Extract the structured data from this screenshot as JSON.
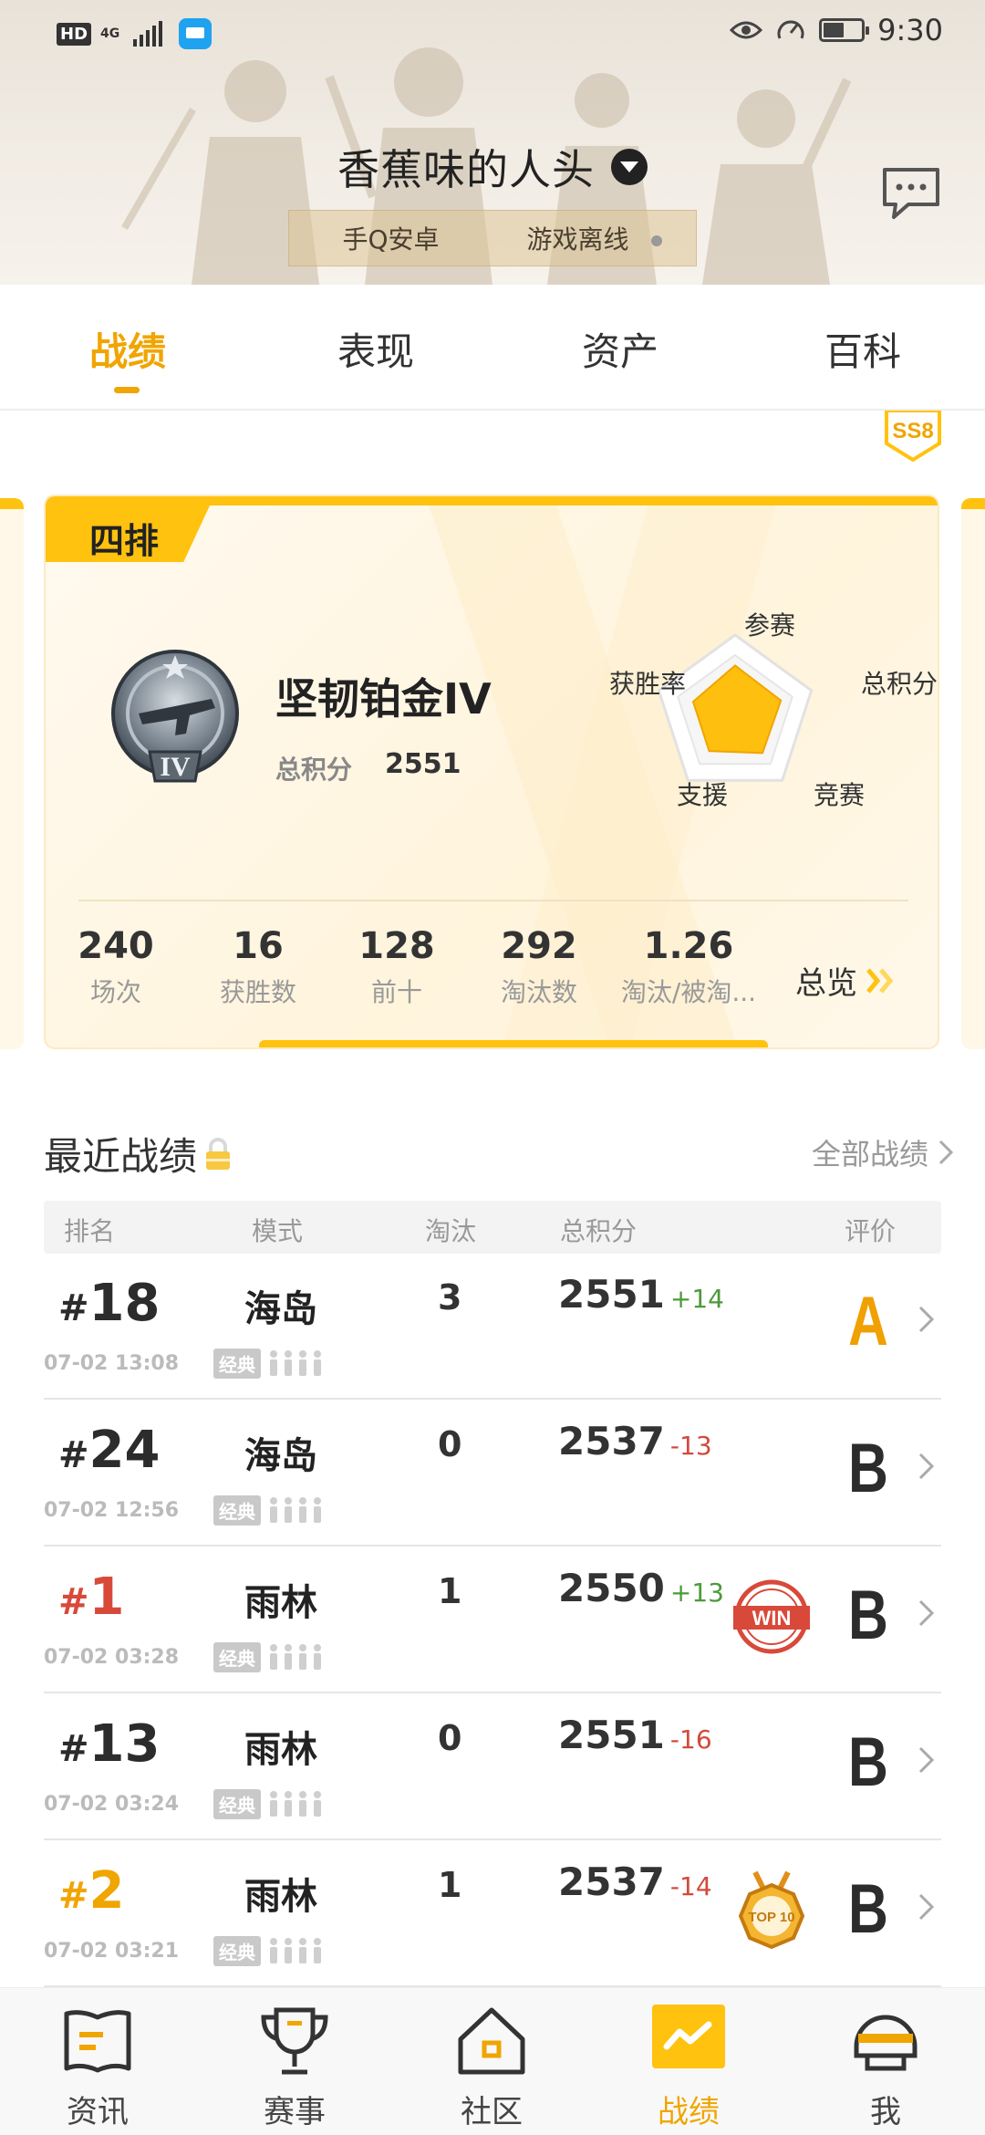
{
  "status_bar": {
    "hd": "HD",
    "network": "4G",
    "time": "9:30"
  },
  "header": {
    "username": "香蕉味的人头",
    "platform": "手Q安卓",
    "game_status": "游戏离线"
  },
  "tabs": [
    {
      "label": "战绩",
      "active": true
    },
    {
      "label": "表现",
      "active": false
    },
    {
      "label": "资产",
      "active": false
    },
    {
      "label": "百科",
      "active": false
    }
  ],
  "season_badge": "SS8",
  "card": {
    "mode": "四排",
    "rank_name": "坚韧铂金IV",
    "rank_emblem_text": "IV",
    "score_label": "总积分",
    "score_value": "2551",
    "radar": {
      "labels": [
        "参赛",
        "总积分",
        "竞赛",
        "支援",
        "获胜率"
      ],
      "values": [
        0.62,
        0.6,
        0.58,
        0.55,
        0.55
      ]
    },
    "stats": [
      {
        "value": "240",
        "label": "场次"
      },
      {
        "value": "16",
        "label": "获胜数"
      },
      {
        "value": "128",
        "label": "前十"
      },
      {
        "value": "292",
        "label": "淘汰数"
      },
      {
        "value": "1.26",
        "label": "淘汰/被淘..."
      }
    ],
    "overview_label": "总览"
  },
  "recent": {
    "title": "最近战绩",
    "all_link": "全部战绩",
    "headers": {
      "rank": "排名",
      "mode": "模式",
      "kills": "淘汰",
      "score": "总积分",
      "grade": "评价"
    },
    "classic_tag": "经典",
    "rows": [
      {
        "rank": "18",
        "time": "07-02 13:08",
        "mode": "海岛",
        "kills": "3",
        "score": "2551",
        "delta": "+14",
        "delta_dir": "up",
        "badge": "",
        "grade": "A"
      },
      {
        "rank": "24",
        "time": "07-02 12:56",
        "mode": "海岛",
        "kills": "0",
        "score": "2537",
        "delta": "-13",
        "delta_dir": "down",
        "badge": "",
        "grade": "B"
      },
      {
        "rank": "1",
        "time": "07-02 03:28",
        "mode": "雨林",
        "kills": "1",
        "score": "2550",
        "delta": "+13",
        "delta_dir": "up",
        "badge": "WIN",
        "grade": "B"
      },
      {
        "rank": "13",
        "time": "07-02 03:24",
        "mode": "雨林",
        "kills": "0",
        "score": "2551",
        "delta": "-16",
        "delta_dir": "down",
        "badge": "",
        "grade": "B"
      },
      {
        "rank": "2",
        "time": "07-02 03:21",
        "mode": "雨林",
        "kills": "1",
        "score": "2537",
        "delta": "-14",
        "delta_dir": "down",
        "badge": "TOP 10",
        "grade": "B"
      }
    ]
  },
  "bottom_nav": [
    {
      "label": "资讯",
      "icon": "news-icon",
      "active": false
    },
    {
      "label": "赛事",
      "icon": "trophy-icon",
      "active": false
    },
    {
      "label": "社区",
      "icon": "home-icon",
      "active": false
    },
    {
      "label": "战绩",
      "icon": "stats-icon",
      "active": true
    },
    {
      "label": "我",
      "icon": "helmet-icon",
      "active": false
    }
  ],
  "colors": {
    "accent": "#f0a500",
    "accent_bright": "#ffc20e",
    "up": "#4c9a3a",
    "down": "#d24a3c",
    "win_red": "#d8493a"
  }
}
